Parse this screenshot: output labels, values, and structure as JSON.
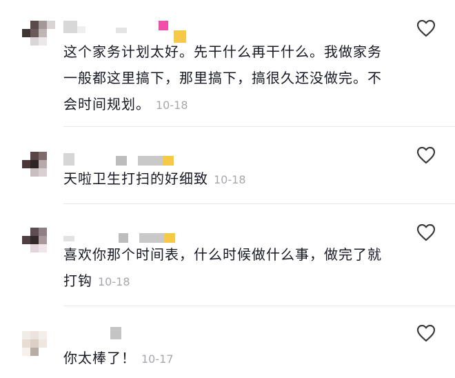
{
  "comments": [
    {
      "text": "这个家务计划太好。先干什么再干什么。我做家务一般都这里搞下，那里搞下，搞很久还没做完。不会时间规划。",
      "date": "10-18",
      "like_icon": "heart-outline-icon"
    },
    {
      "text": "天啦卫生打扫的好细致",
      "date": "10-18",
      "like_icon": "heart-outline-icon"
    },
    {
      "text": "喜欢你那个时间表，什么时候做什么事，做完了就打钩",
      "date": "10-18",
      "like_icon": "heart-outline-icon"
    },
    {
      "text": "你太棒了！",
      "date": "10-17",
      "like_icon": "heart-outline-icon"
    }
  ],
  "colors": {
    "text": "#161823",
    "date": "#a6a7ab",
    "divider": "#e8e8e8",
    "pink_block": "#f04ea8",
    "yellow_block": "#f7c948"
  }
}
